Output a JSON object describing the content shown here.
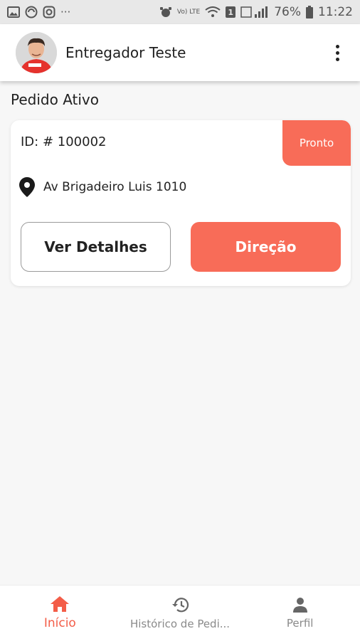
{
  "status_bar": {
    "network_label": "Vo) LTE",
    "sim_label": "1",
    "battery": "76%",
    "time": "11:22"
  },
  "header": {
    "user_name": "Entregador Teste"
  },
  "main": {
    "section_title": "Pedido Ativo",
    "order": {
      "id_label": "ID: # 100002",
      "status": "Pronto",
      "address": "Av Brigadeiro Luis 1010",
      "details_button": "Ver Detalhes",
      "direction_button": "Direção"
    }
  },
  "bottom_nav": {
    "items": [
      {
        "label": "Início",
        "icon": "home-icon",
        "active": true
      },
      {
        "label": "Histórico de Pedi...",
        "icon": "history-icon",
        "active": false
      },
      {
        "label": "Perfil",
        "icon": "person-icon",
        "active": false
      }
    ]
  },
  "colors": {
    "accent": "#f86c58",
    "active_nav": "#f35d48",
    "background": "#f7f7f7"
  }
}
